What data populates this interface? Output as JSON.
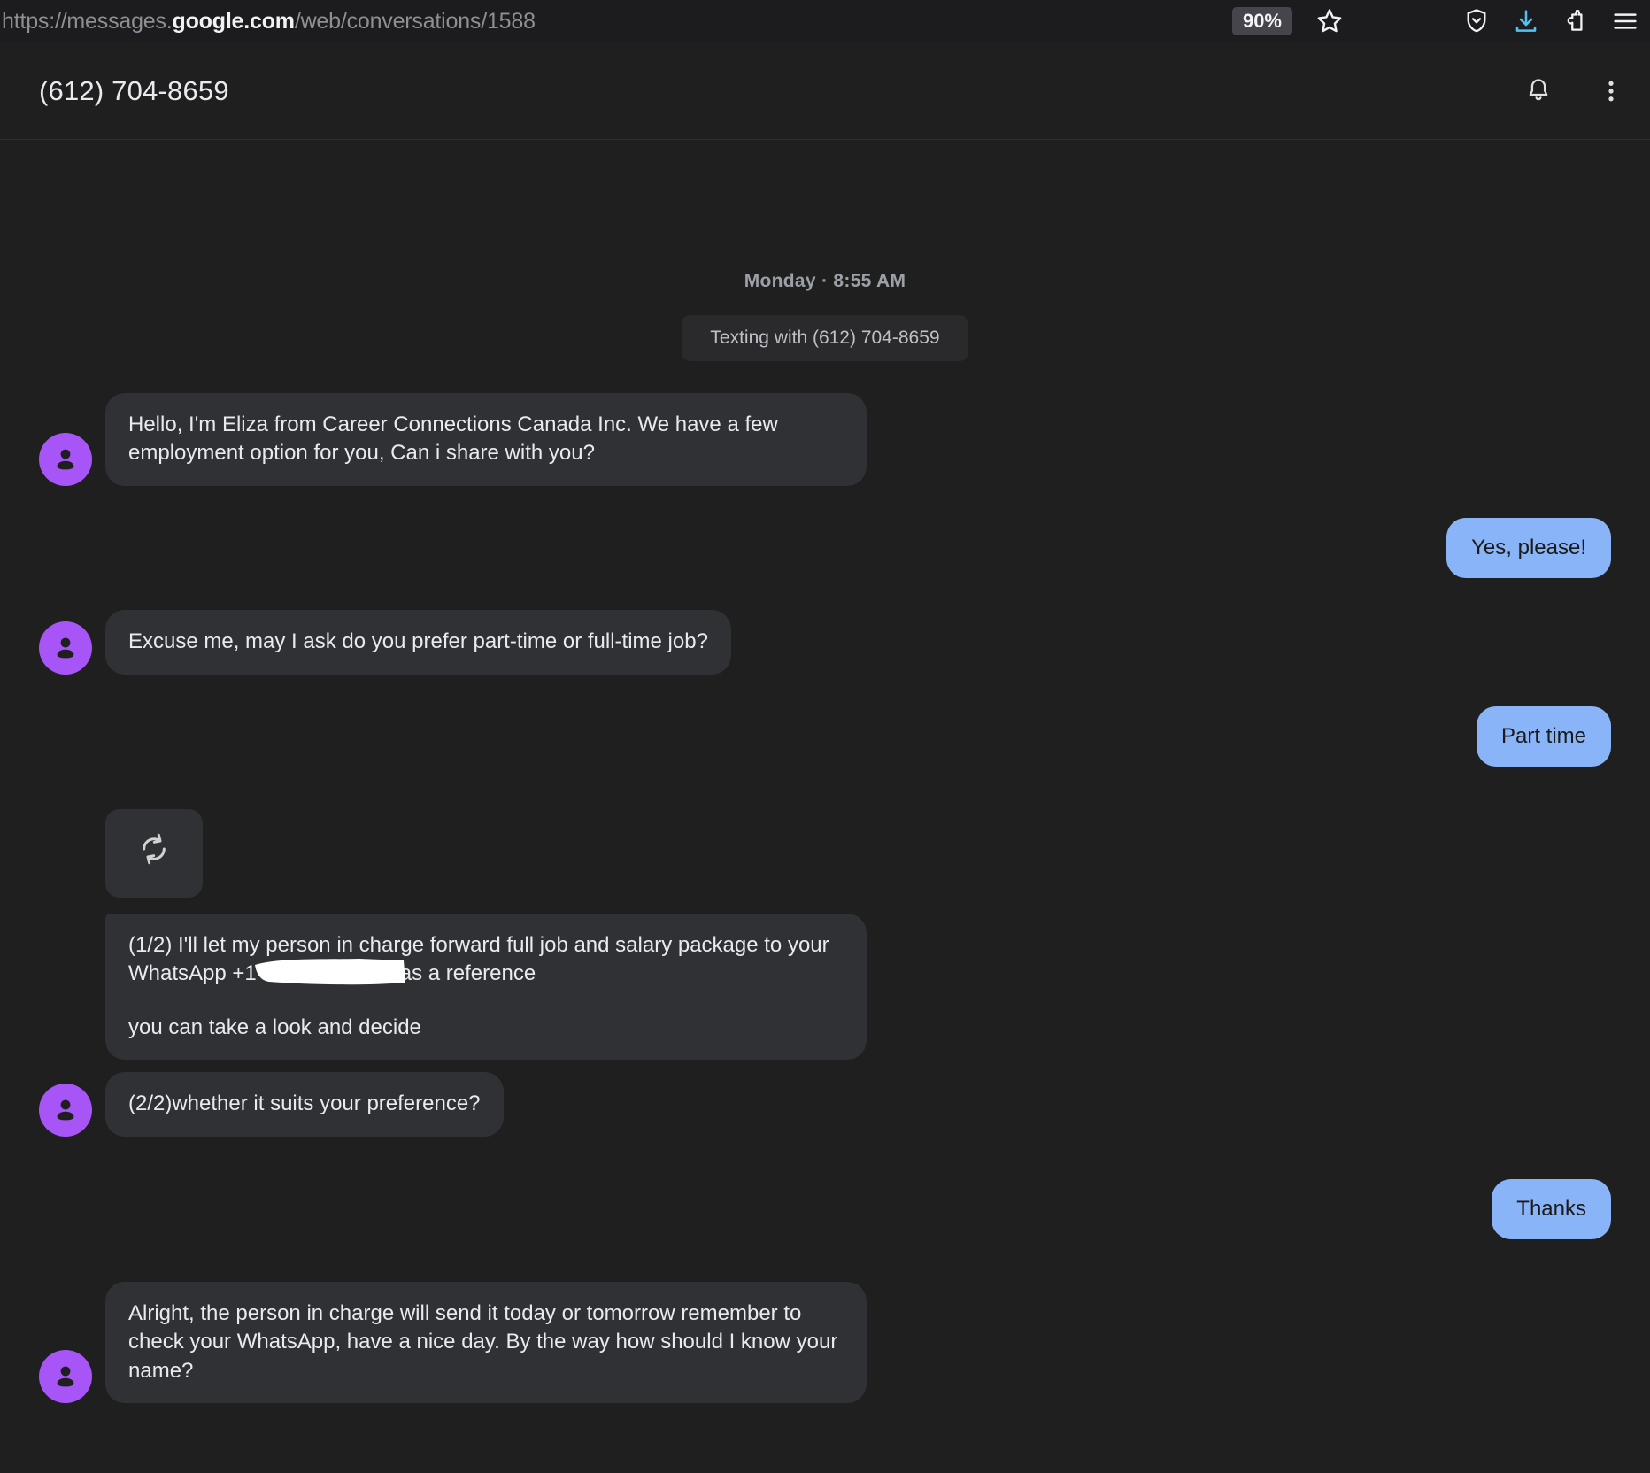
{
  "browser": {
    "url_scheme": "https://messages.",
    "url_host": "google.com",
    "url_path": "/web/conversations/1588",
    "zoom_level": "90%",
    "icons": {
      "bookmark": "star-icon",
      "shield": "tracking-protection-shield-icon",
      "download": "download-arrow-icon",
      "extensions": "puzzle-piece-icon",
      "menu": "hamburger-menu-icon"
    },
    "accent_download": "#4fc3f7"
  },
  "header": {
    "conversation_title": "(612) 704-8659",
    "notifications_label": "Notifications",
    "overflow_label": "More options"
  },
  "conversation": {
    "date_divider": "Monday · 8:55 AM",
    "system_chip": "Texting with (612) 704-8659",
    "messages": [
      {
        "id": "m1",
        "direction": "in",
        "text": "Hello, I'm Eliza from  Career Connections Canada Inc. We have a few employment option for you, Can i share with you?"
      },
      {
        "id": "m2",
        "direction": "out",
        "text": "Yes, please!"
      },
      {
        "id": "m3",
        "direction": "in",
        "text": "Excuse me, may I ask do you prefer part-time or full-time job?"
      },
      {
        "id": "m4",
        "direction": "out",
        "text": "Part time"
      },
      {
        "id": "m5",
        "direction": "in",
        "type": "icon",
        "icon": "sync-arrows-icon"
      },
      {
        "id": "m6",
        "direction": "in",
        "text_line1_a": "(1/2) I'll let my person in charge forward full job and salary package to your WhatsApp +1",
        "text_line1_b": "as a reference",
        "text_line2": "you can take a look and decide"
      },
      {
        "id": "m7",
        "direction": "in",
        "text": "(2/2)whether it suits your preference?"
      },
      {
        "id": "m8",
        "direction": "out",
        "text": "Thanks"
      },
      {
        "id": "m9",
        "direction": "in",
        "text": "Alright, the person in charge will send it today or tomorrow remember to check your WhatsApp, have a nice day. By the way how should I know your name?"
      }
    ]
  },
  "colors": {
    "page_bg": "#1f1f1f",
    "incoming_bubble": "#303134",
    "outgoing_bubble": "#8ab4f8",
    "avatar": "#a855f7",
    "text_primary": "#e8eaed",
    "text_secondary": "#9aa0a6"
  }
}
